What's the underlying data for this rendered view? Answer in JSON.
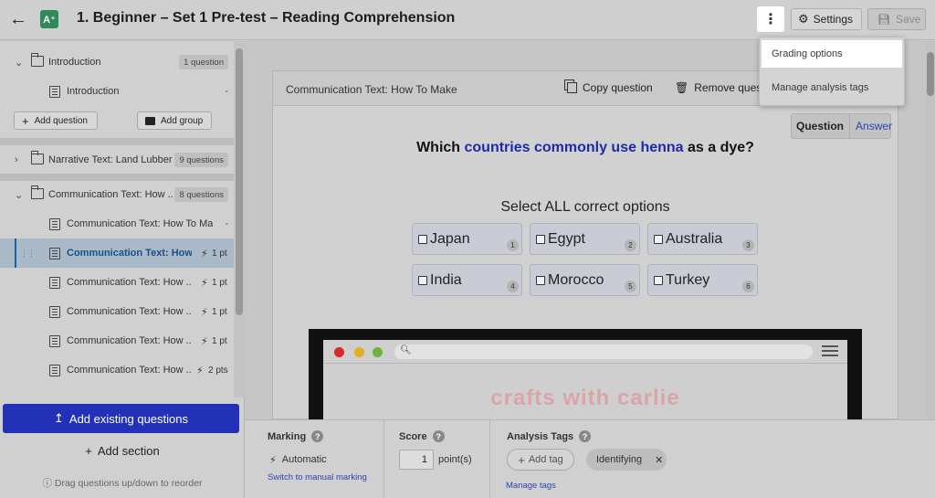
{
  "header": {
    "title": "1. Beginner – Set 1 Pre-test – Reading Comprehension",
    "settings_label": "Settings",
    "save_label": "Save",
    "app_logo_text": "A⁺"
  },
  "menu": {
    "items": [
      "Grading options",
      "Manage analysis tags"
    ]
  },
  "sidebar": {
    "sections": [
      {
        "label": "Introduction",
        "count": "1 question"
      },
      {
        "label": "Narrative Text: Land Lubber",
        "count": "9 questions"
      },
      {
        "label": "Communication Text: How ...",
        "count": "8 questions"
      }
    ],
    "intro_item": "Introduction",
    "intro_item_points": "-",
    "add_question": "Add question",
    "add_group": "Add group",
    "questions": [
      {
        "label": "Communication Text: How To Mak...",
        "points": "-"
      },
      {
        "label": "Communication Text: How...",
        "points": "1 pt"
      },
      {
        "label": "Communication Text: How ...",
        "points": "1 pt"
      },
      {
        "label": "Communication Text: How ...",
        "points": "1 pt"
      },
      {
        "label": "Communication Text: How ...",
        "points": "1 pt"
      },
      {
        "label": "Communication Text: How ...",
        "points": "2 pts"
      }
    ],
    "add_existing": "Add existing questions",
    "add_section": "Add section",
    "drag_hint": "Drag questions up/down to reorder"
  },
  "card": {
    "title": "Communication Text: How To Make",
    "copy_label": "Copy question",
    "remove_label": "Remove quest"
  },
  "toggle": {
    "question": "Question",
    "answer": "Answer"
  },
  "question": {
    "prefix": "Which ",
    "highlight": "countries commonly use henna",
    "suffix": " as a dye?",
    "instruction": "Select ALL correct options",
    "options": [
      {
        "text": "Japan",
        "num": "1"
      },
      {
        "text": "Egypt",
        "num": "2"
      },
      {
        "text": "Australia",
        "num": "3"
      },
      {
        "text": "India",
        "num": "4"
      },
      {
        "text": "Morocco",
        "num": "5"
      },
      {
        "text": "Turkey",
        "num": "6"
      }
    ]
  },
  "image": {
    "site_text": "crafts with carlie"
  },
  "bottom": {
    "marking_title": "Marking",
    "marking_value": "Automatic",
    "switch_link": "Switch to manual marking",
    "score_title": "Score",
    "score_value": "1",
    "score_unit": "point(s)",
    "tags_title": "Analysis Tags",
    "add_tag": "Add tag",
    "tag": "Identifying",
    "manage_tags": "Manage tags"
  },
  "colors": {
    "accent": "#2330b8",
    "link": "#2c44b0",
    "selected_row": "#a9b9c8"
  }
}
